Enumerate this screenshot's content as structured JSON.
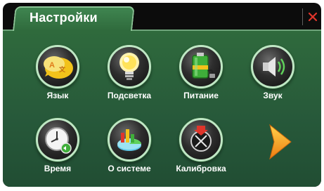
{
  "header": {
    "title": "Настройки",
    "close_icon": "close-icon"
  },
  "colors": {
    "panel": "#2f6a3c",
    "icon_ring": "#bfe7c4",
    "close": "#e0352b",
    "arrow": "#f39a1e"
  },
  "items": [
    {
      "label": "Язык",
      "icon": "language-icon"
    },
    {
      "label": "Подсветка",
      "icon": "lightbulb-icon"
    },
    {
      "label": "Питание",
      "icon": "battery-icon"
    },
    {
      "label": "Звук",
      "icon": "speaker-icon"
    },
    {
      "label": "Время",
      "icon": "clock-icon"
    },
    {
      "label": "О системе",
      "icon": "system-info-icon"
    },
    {
      "label": "Калибровка",
      "icon": "calibration-icon"
    }
  ],
  "next_icon": "next-page-arrow-icon"
}
